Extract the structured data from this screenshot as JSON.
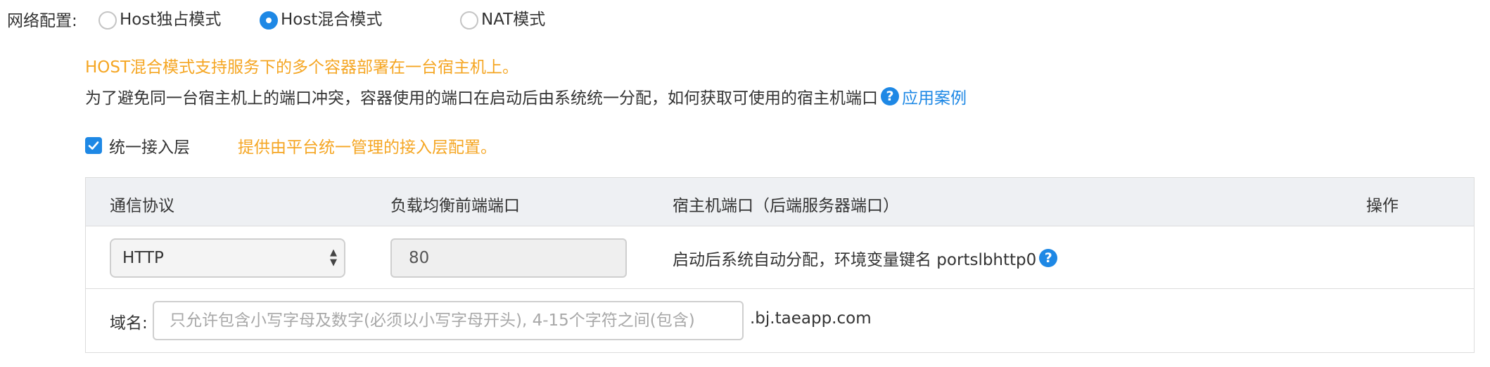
{
  "network": {
    "label": "网络配置:",
    "options": [
      {
        "label": "Host独占模式",
        "checked": false
      },
      {
        "label": "Host混合模式",
        "checked": true
      },
      {
        "label": "NAT模式",
        "checked": false
      }
    ]
  },
  "mode_hint": "HOST混合模式支持服务下的多个容器部署在一台宿主机上。",
  "description": {
    "text": "为了避免同一台宿主机上的端口冲突，容器使用的端口在启动后由系统统一分配，如何获取可使用的宿主机端口",
    "help_icon": "question-circle-icon",
    "link": "应用案例"
  },
  "access_layer": {
    "checked": true,
    "label": "统一接入层",
    "hint": "提供由平台统一管理的接入层配置。"
  },
  "table": {
    "headers": [
      "通信协议",
      "负载均衡前端端口",
      "宿主机端口（后端服务器端口）",
      "操作"
    ],
    "row": {
      "protocol": "HTTP",
      "lb_port": "80",
      "host_port_text": "启动后系统自动分配，环境变量键名 portslbhttp0"
    },
    "domain": {
      "label": "域名:",
      "placeholder": "只允许包含小写字母及数字(必须以小写字母开头), 4-15个字符之间(包含)",
      "value": "",
      "suffix": ".bj.taeapp.com"
    }
  },
  "colors": {
    "accent": "#1e88e5",
    "warning": "#f5a623",
    "header_bg": "#eef0f3"
  }
}
